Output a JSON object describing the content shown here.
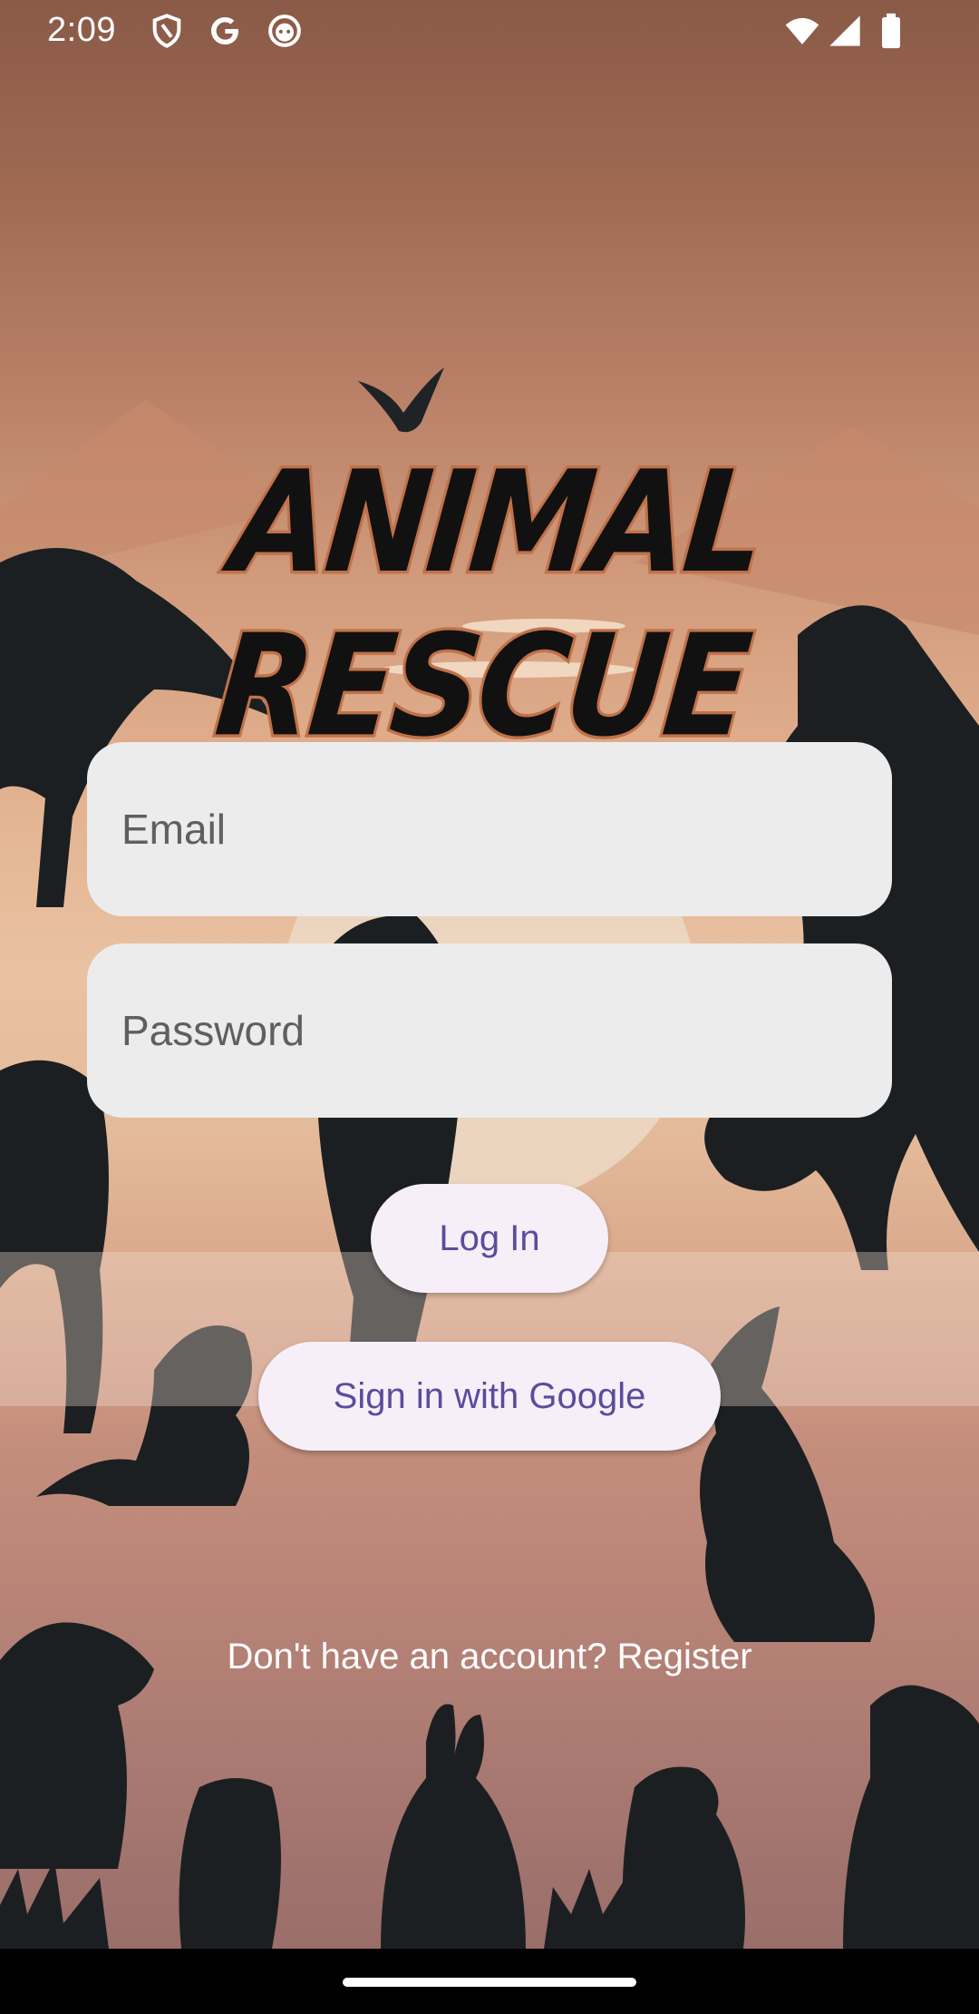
{
  "status_bar": {
    "time": "2:09",
    "left_icons": [
      "shield-icon",
      "google-g-icon",
      "face-icon"
    ],
    "right_icons": [
      "wifi-icon",
      "signal-icon",
      "battery-icon"
    ]
  },
  "app": {
    "title": "ANIMAL RESCUE"
  },
  "form": {
    "email_placeholder": "Email",
    "password_placeholder": "Password",
    "login_label": "Log In",
    "google_label": "Sign in with Google",
    "register_text": "Don't have an account? Register"
  },
  "colors": {
    "button_bg": "#f6eff8",
    "button_text": "#5b4c9c",
    "field_bg": "#ececec",
    "title_outline": "#c0724a"
  }
}
